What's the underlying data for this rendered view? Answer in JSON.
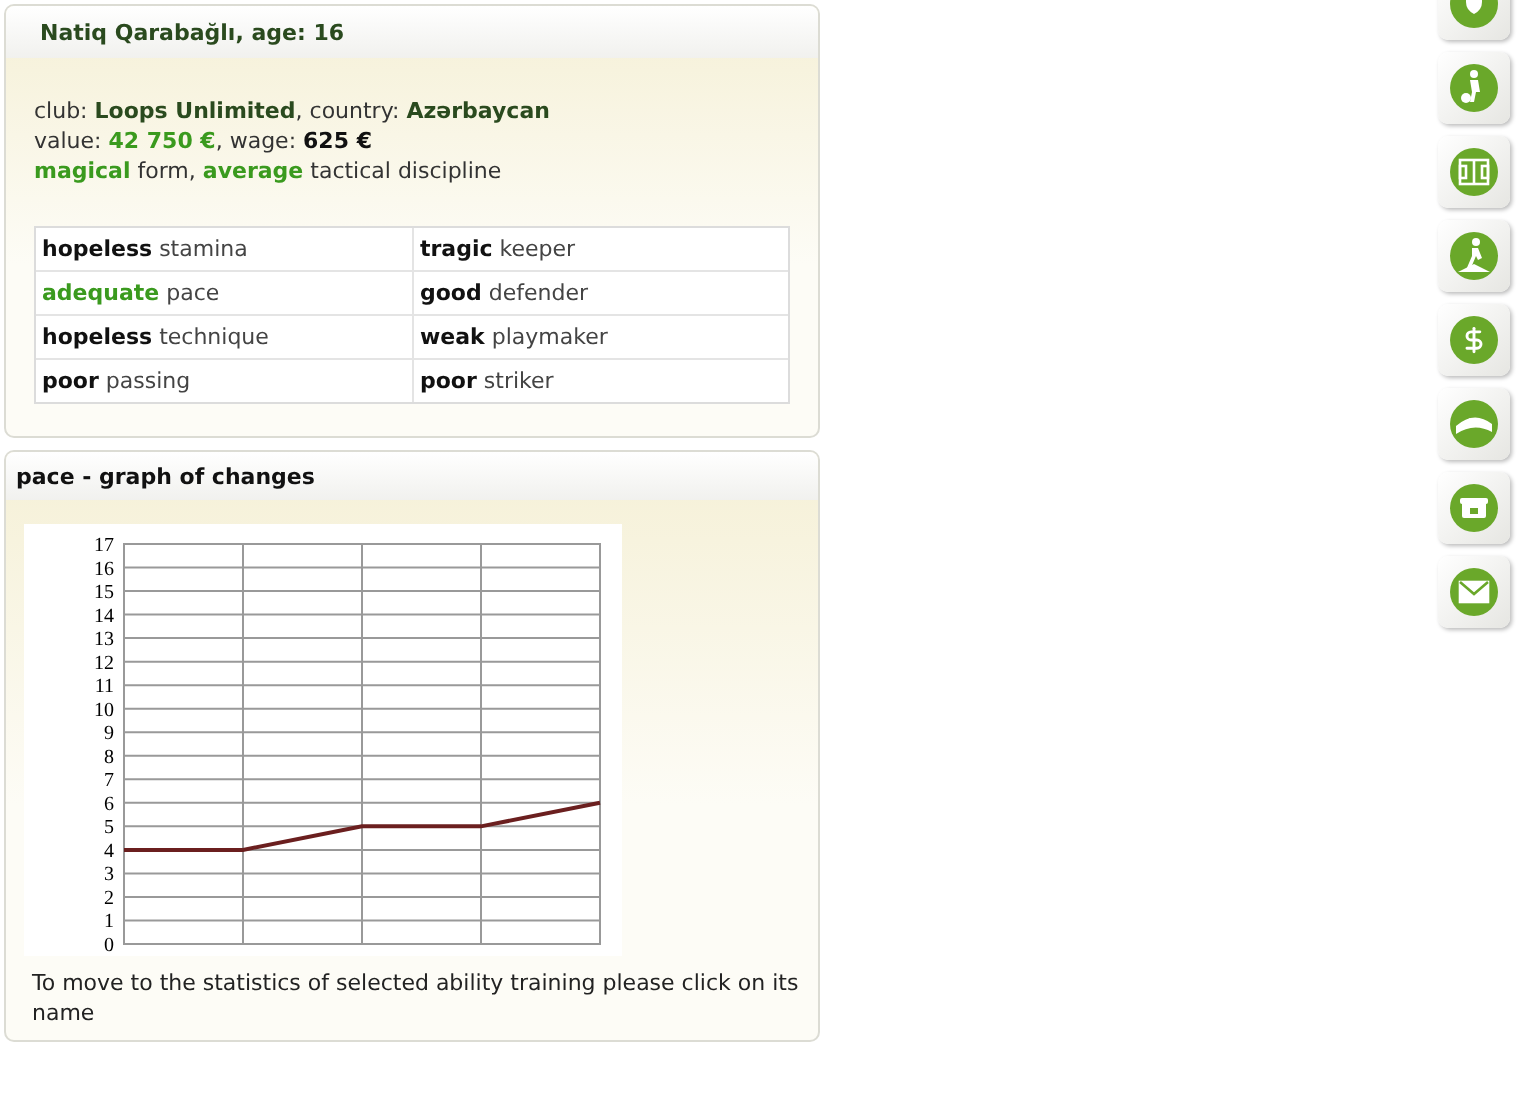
{
  "player_panel": {
    "title": "Natiq Qarabağlı, age: 16",
    "info_lines": [
      [
        {
          "text": "club: ",
          "bold": false,
          "color": "#333333"
        },
        {
          "text": "Loops Unlimited",
          "bold": true,
          "color": "#2a4a1e"
        },
        {
          "text": ", country: ",
          "bold": false,
          "color": "#333333"
        },
        {
          "text": "Azərbaycan",
          "bold": true,
          "color": "#2a4a1e"
        }
      ],
      [
        {
          "text": "value: ",
          "bold": false,
          "color": "#333333"
        },
        {
          "text": "42 750 €",
          "bold": true,
          "color": "#3a9a1e"
        },
        {
          "text": ", wage: ",
          "bold": false,
          "color": "#333333"
        },
        {
          "text": "625 €",
          "bold": true,
          "color": "#111111"
        }
      ],
      [
        {
          "text": "magical",
          "bold": true,
          "color": "#3a9a1e"
        },
        {
          "text": " form, ",
          "bold": false,
          "color": "#333333"
        },
        {
          "text": "average",
          "bold": true,
          "color": "#3a9a1e"
        },
        {
          "text": " tactical discipline",
          "bold": false,
          "color": "#333333"
        }
      ]
    ],
    "skills": [
      [
        {
          "level": "hopeless",
          "skill": "stamina",
          "color": "#111111"
        },
        {
          "level": "tragic",
          "skill": "keeper",
          "color": "#111111"
        }
      ],
      [
        {
          "level": "adequate",
          "skill": "pace",
          "color": "#3a9a1e"
        },
        {
          "level": "good",
          "skill": "defender",
          "color": "#111111"
        }
      ],
      [
        {
          "level": "hopeless",
          "skill": "technique",
          "color": "#111111"
        },
        {
          "level": "weak",
          "skill": "playmaker",
          "color": "#111111"
        }
      ],
      [
        {
          "level": "poor",
          "skill": "passing",
          "color": "#111111"
        },
        {
          "level": "poor",
          "skill": "striker",
          "color": "#111111"
        }
      ]
    ]
  },
  "graph_panel": {
    "title": "pace - graph of changes",
    "chart_data": {
      "type": "line",
      "grid": true,
      "series": [
        {
          "color": "#6b1f1f",
          "values": [
            4,
            4,
            5,
            5,
            6
          ]
        }
      ],
      "ylim": [
        0,
        17
      ],
      "yticks": [
        0,
        1,
        2,
        3,
        4,
        5,
        6,
        7,
        8,
        9,
        10,
        11,
        12,
        13,
        14,
        15,
        16,
        17
      ]
    },
    "note": "To move to the statistics of selected ability training please click on its name"
  }
}
